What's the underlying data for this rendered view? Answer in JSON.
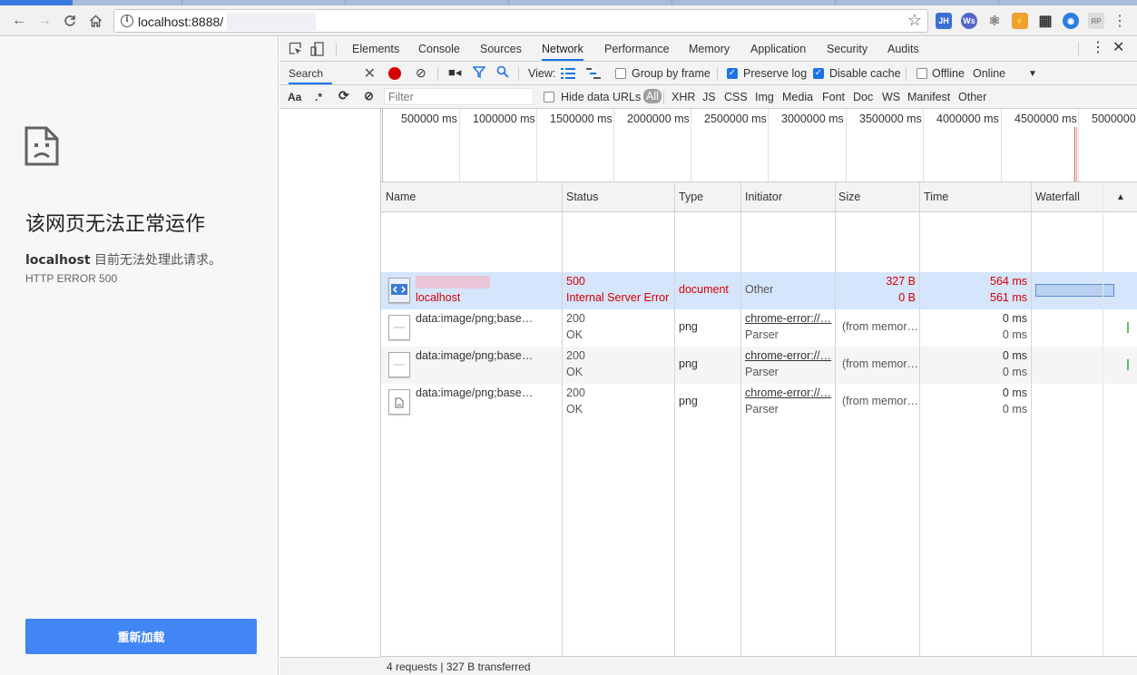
{
  "browser": {
    "url": "localhost:8888/",
    "extensions": [
      "JH",
      "Ws",
      "⚛",
      "⚡",
      "▦",
      "◉",
      "RP"
    ]
  },
  "page": {
    "error_title": "该网页无法正常运作",
    "error_host": "localhost",
    "error_desc": " 目前无法处理此请求。",
    "error_code": "HTTP ERROR 500",
    "reload_label": "重新加载"
  },
  "devtools": {
    "tabs": [
      "Elements",
      "Console",
      "Sources",
      "Network",
      "Performance",
      "Memory",
      "Application",
      "Security",
      "Audits"
    ],
    "active_tab": "Network",
    "search": {
      "label": "Search",
      "case_label": "Aa",
      "regex_label": ".*"
    },
    "toolbar": {
      "view_label": "View:",
      "group_by_frame": "Group by frame",
      "preserve_log": "Preserve log",
      "disable_cache": "Disable cache",
      "offline": "Offline",
      "throttle": "Online"
    },
    "filter": {
      "placeholder": "Filter",
      "hide_data_urls": "Hide data URLs",
      "types": [
        "All",
        "XHR",
        "JS",
        "CSS",
        "Img",
        "Media",
        "Font",
        "Doc",
        "WS",
        "Manifest",
        "Other"
      ]
    },
    "overview_ticks": [
      "500000 ms",
      "1000000 ms",
      "1500000 ms",
      "2000000 ms",
      "2500000 ms",
      "3000000 ms",
      "3500000 ms",
      "4000000 ms",
      "4500000 ms",
      "5000000 ms"
    ],
    "columns": [
      "Name",
      "Status",
      "Type",
      "Initiator",
      "Size",
      "Time",
      "Waterfall"
    ],
    "requests": [
      {
        "name": "",
        "host": "localhost",
        "status": "500",
        "status_text": "Internal Server Error",
        "type": "document",
        "initiator": "Other",
        "initiator_sub": "",
        "size": "327 B",
        "size_sub": "0 B",
        "time": "564 ms",
        "time_sub": "561 ms"
      },
      {
        "name": "data:image/png;base…",
        "host": "",
        "status": "200",
        "status_text": "OK",
        "type": "png",
        "initiator": "chrome-error://…",
        "initiator_sub": "Parser",
        "size": "(from memor…",
        "size_sub": "",
        "time": "0 ms",
        "time_sub": "0 ms"
      },
      {
        "name": "data:image/png;base…",
        "host": "",
        "status": "200",
        "status_text": "OK",
        "type": "png",
        "initiator": "chrome-error://…",
        "initiator_sub": "Parser",
        "size": "(from memor…",
        "size_sub": "",
        "time": "0 ms",
        "time_sub": "0 ms"
      },
      {
        "name": "data:image/png;base…",
        "host": "",
        "status": "200",
        "status_text": "OK",
        "type": "png",
        "initiator": "chrome-error://…",
        "initiator_sub": "Parser",
        "size": "(from memor…",
        "size_sub": "",
        "time": "0 ms",
        "time_sub": "0 ms"
      }
    ],
    "summary": "4 requests | 327 B transferred"
  },
  "colors": {
    "accent": "#1a73e8",
    "error": "#d60000",
    "reload": "#4285f4",
    "selected_row": "#d5e5fb"
  }
}
